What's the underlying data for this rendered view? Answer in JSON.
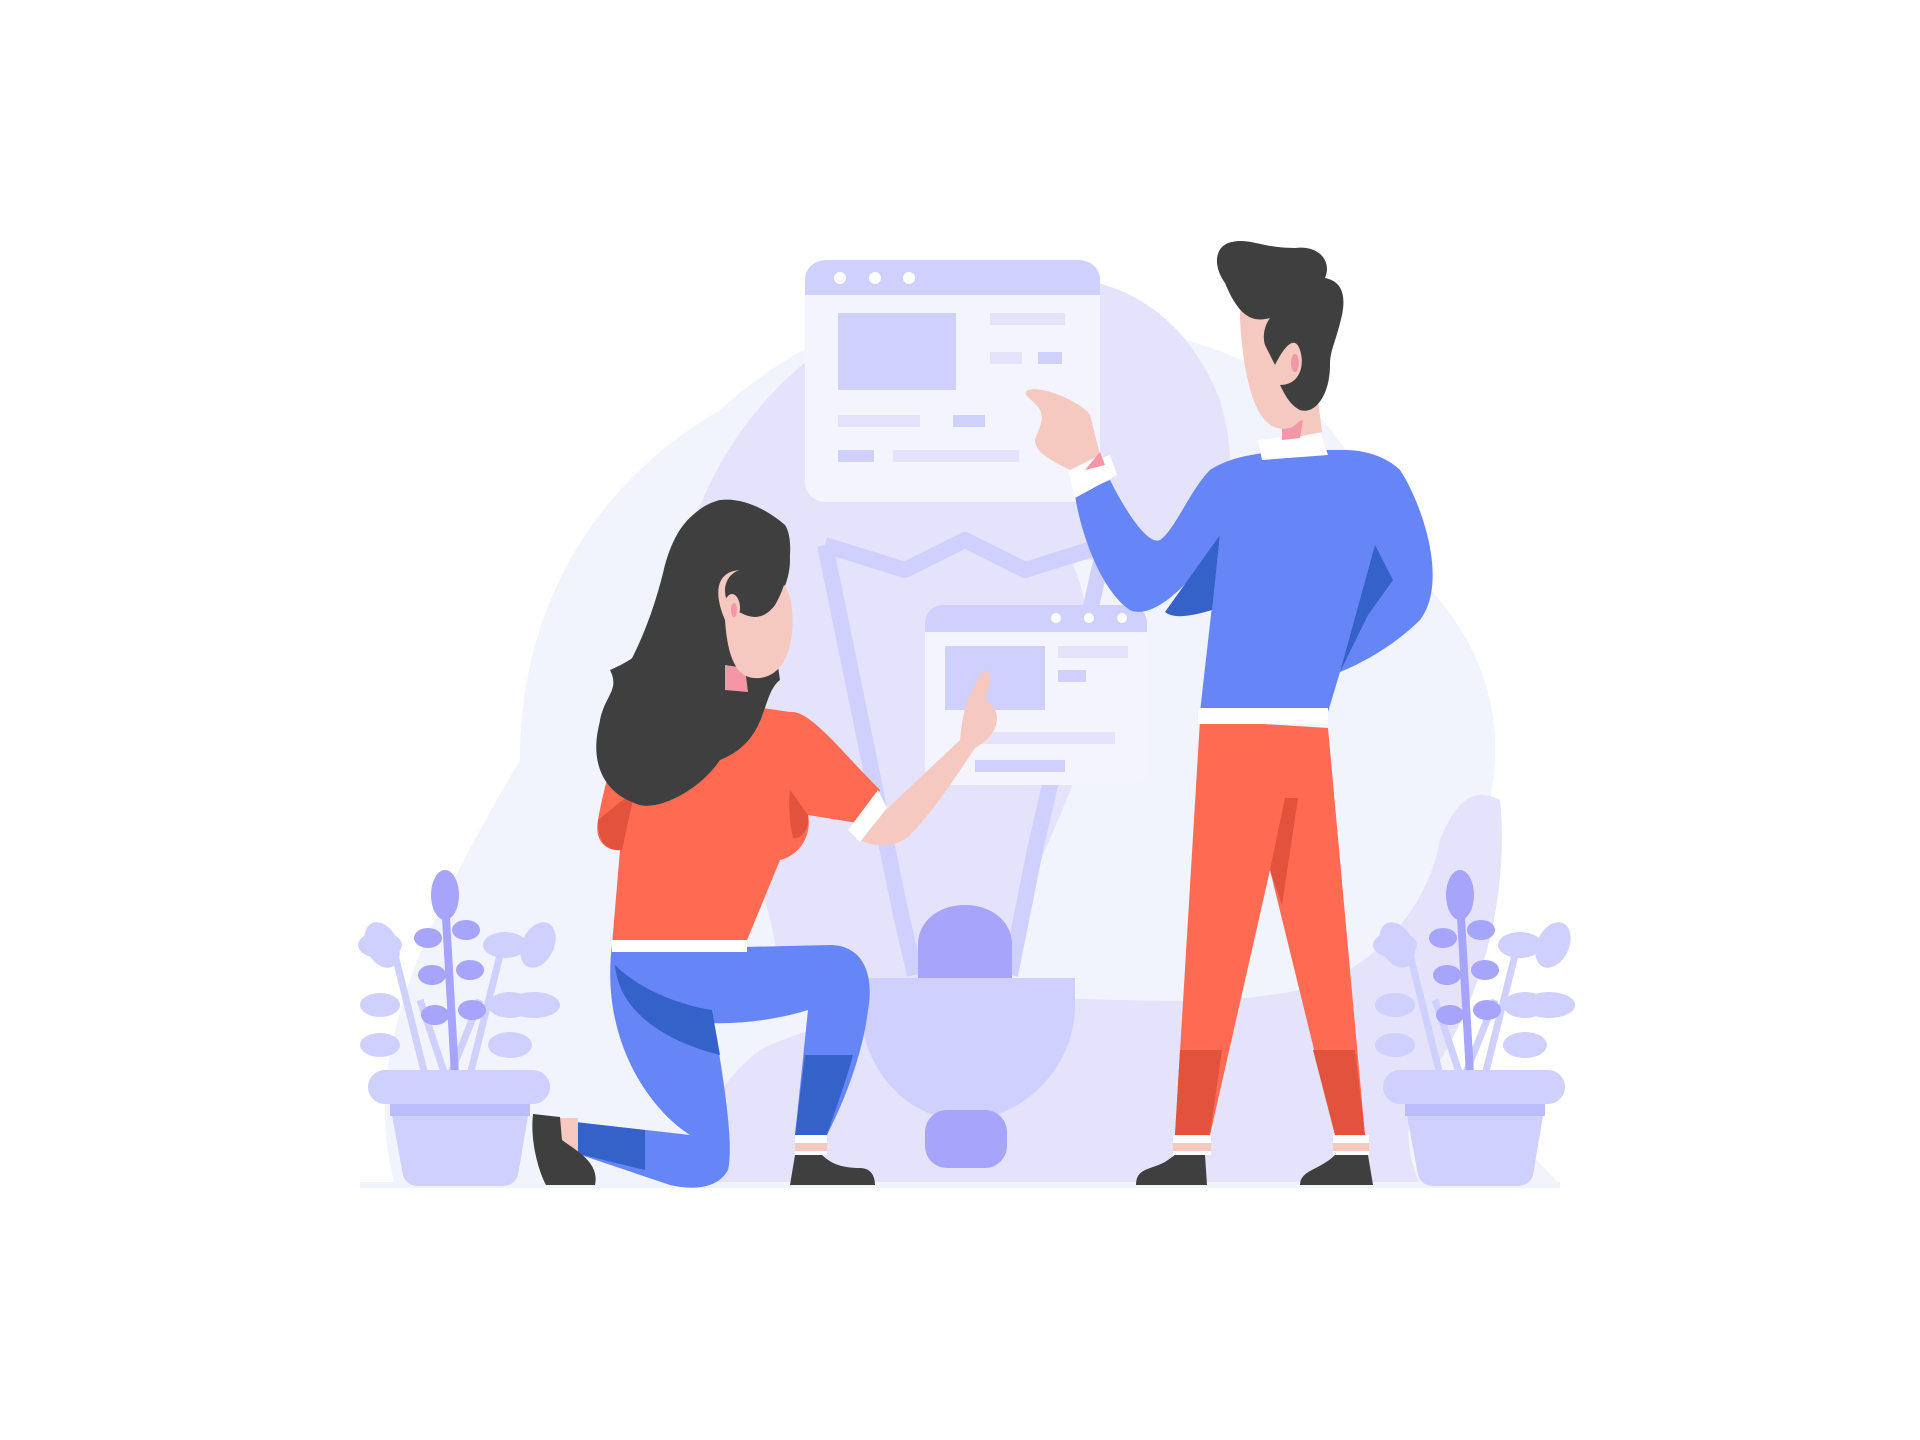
{
  "scene": {
    "subject": "illustration",
    "palette": {
      "background": "#ffffff",
      "blob_light": "#f1f3fd",
      "blob_mid": "#e4e3fb",
      "lavender": "#cfd0fd",
      "lavender_dark": "#a6a4fb",
      "panel": "#f3f4fe",
      "coral": "#ff6a52",
      "coral_dark": "#e2523d",
      "blue": "#6686f7",
      "blue_dark": "#3462c9",
      "hair": "#3f3f3f",
      "skin": "#f5c9bf",
      "skin_pink": "#f396a6"
    },
    "icons": [
      "bulb-icon",
      "plant-icon",
      "window-icon"
    ]
  }
}
